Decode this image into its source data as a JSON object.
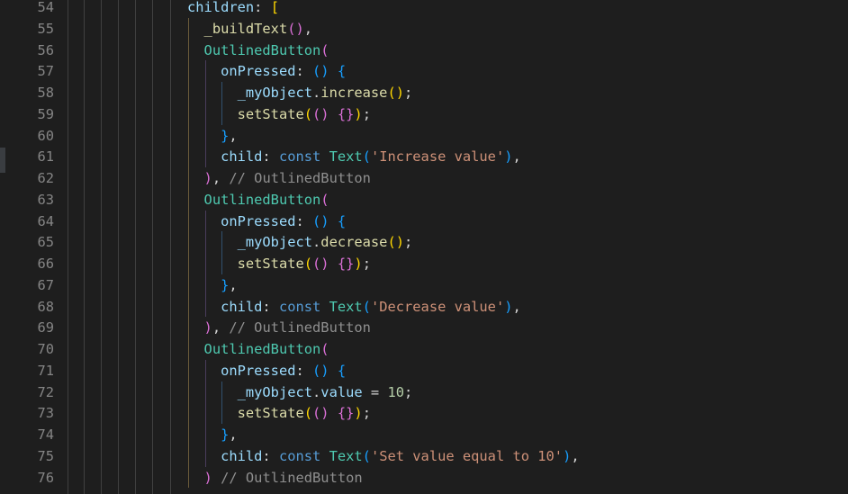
{
  "colors": {
    "background": "#1e1e1e",
    "line_number": "#858585",
    "keyword": "#569cd6",
    "class": "#4ec9b0",
    "function": "#dcdcaa",
    "property": "#9cdcfe",
    "string": "#ce9178",
    "number": "#b5cea8",
    "comment": "#8f8f8f",
    "bracket_gold": "#ffd700",
    "bracket_pink": "#da70d6",
    "bracket_blue": "#179fff",
    "plain": "#d4d4d4"
  },
  "editor": {
    "lines": [
      {
        "num": "54",
        "indent": "",
        "tokens": [
          {
            "t": "children",
            "c": "property"
          },
          {
            "t": ": ",
            "c": "plain"
          },
          {
            "t": "[",
            "c": "bracket_gold"
          }
        ]
      },
      {
        "num": "55",
        "indent": "  ",
        "tokens": [
          {
            "t": "_buildText",
            "c": "function"
          },
          {
            "t": "()",
            "c": "bracket_pink"
          },
          {
            "t": ",",
            "c": "plain"
          }
        ]
      },
      {
        "num": "56",
        "indent": "  ",
        "tokens": [
          {
            "t": "OutlinedButton",
            "c": "class"
          },
          {
            "t": "(",
            "c": "bracket_pink"
          }
        ]
      },
      {
        "num": "57",
        "indent": "    ",
        "tokens": [
          {
            "t": "onPressed",
            "c": "property"
          },
          {
            "t": ": ",
            "c": "plain"
          },
          {
            "t": "()",
            "c": "bracket_blue"
          },
          {
            "t": " ",
            "c": "plain"
          },
          {
            "t": "{",
            "c": "bracket_blue"
          }
        ]
      },
      {
        "num": "58",
        "indent": "      ",
        "tokens": [
          {
            "t": "_myObject",
            "c": "property"
          },
          {
            "t": ".",
            "c": "plain"
          },
          {
            "t": "increase",
            "c": "function"
          },
          {
            "t": "()",
            "c": "bracket_gold"
          },
          {
            "t": ";",
            "c": "plain"
          }
        ]
      },
      {
        "num": "59",
        "indent": "      ",
        "tokens": [
          {
            "t": "setState",
            "c": "function"
          },
          {
            "t": "(",
            "c": "bracket_gold"
          },
          {
            "t": "()",
            "c": "bracket_pink"
          },
          {
            "t": " ",
            "c": "plain"
          },
          {
            "t": "{}",
            "c": "bracket_pink"
          },
          {
            "t": ")",
            "c": "bracket_gold"
          },
          {
            "t": ";",
            "c": "plain"
          }
        ]
      },
      {
        "num": "60",
        "indent": "    ",
        "tokens": [
          {
            "t": "}",
            "c": "bracket_blue"
          },
          {
            "t": ",",
            "c": "plain"
          }
        ]
      },
      {
        "num": "61",
        "indent": "    ",
        "tokens": [
          {
            "t": "child",
            "c": "property"
          },
          {
            "t": ": ",
            "c": "plain"
          },
          {
            "t": "const",
            "c": "keyword"
          },
          {
            "t": " ",
            "c": "plain"
          },
          {
            "t": "Text",
            "c": "class"
          },
          {
            "t": "(",
            "c": "bracket_blue"
          },
          {
            "t": "'Increase value'",
            "c": "string"
          },
          {
            "t": ")",
            "c": "bracket_blue"
          },
          {
            "t": ",",
            "c": "plain"
          }
        ]
      },
      {
        "num": "62",
        "indent": "  ",
        "tokens": [
          {
            "t": ")",
            "c": "bracket_pink"
          },
          {
            "t": ", ",
            "c": "plain"
          },
          {
            "t": "// OutlinedButton",
            "c": "comment"
          }
        ]
      },
      {
        "num": "63",
        "indent": "  ",
        "tokens": [
          {
            "t": "OutlinedButton",
            "c": "class"
          },
          {
            "t": "(",
            "c": "bracket_pink"
          }
        ]
      },
      {
        "num": "64",
        "indent": "    ",
        "tokens": [
          {
            "t": "onPressed",
            "c": "property"
          },
          {
            "t": ": ",
            "c": "plain"
          },
          {
            "t": "()",
            "c": "bracket_blue"
          },
          {
            "t": " ",
            "c": "plain"
          },
          {
            "t": "{",
            "c": "bracket_blue"
          }
        ]
      },
      {
        "num": "65",
        "indent": "      ",
        "tokens": [
          {
            "t": "_myObject",
            "c": "property"
          },
          {
            "t": ".",
            "c": "plain"
          },
          {
            "t": "decrease",
            "c": "function"
          },
          {
            "t": "()",
            "c": "bracket_gold"
          },
          {
            "t": ";",
            "c": "plain"
          }
        ]
      },
      {
        "num": "66",
        "indent": "      ",
        "tokens": [
          {
            "t": "setState",
            "c": "function"
          },
          {
            "t": "(",
            "c": "bracket_gold"
          },
          {
            "t": "()",
            "c": "bracket_pink"
          },
          {
            "t": " ",
            "c": "plain"
          },
          {
            "t": "{}",
            "c": "bracket_pink"
          },
          {
            "t": ")",
            "c": "bracket_gold"
          },
          {
            "t": ";",
            "c": "plain"
          }
        ]
      },
      {
        "num": "67",
        "indent": "    ",
        "tokens": [
          {
            "t": "}",
            "c": "bracket_blue"
          },
          {
            "t": ",",
            "c": "plain"
          }
        ]
      },
      {
        "num": "68",
        "indent": "    ",
        "tokens": [
          {
            "t": "child",
            "c": "property"
          },
          {
            "t": ": ",
            "c": "plain"
          },
          {
            "t": "const",
            "c": "keyword"
          },
          {
            "t": " ",
            "c": "plain"
          },
          {
            "t": "Text",
            "c": "class"
          },
          {
            "t": "(",
            "c": "bracket_blue"
          },
          {
            "t": "'Decrease value'",
            "c": "string"
          },
          {
            "t": ")",
            "c": "bracket_blue"
          },
          {
            "t": ",",
            "c": "plain"
          }
        ]
      },
      {
        "num": "69",
        "indent": "  ",
        "tokens": [
          {
            "t": ")",
            "c": "bracket_pink"
          },
          {
            "t": ", ",
            "c": "plain"
          },
          {
            "t": "// OutlinedButton",
            "c": "comment"
          }
        ]
      },
      {
        "num": "70",
        "indent": "  ",
        "tokens": [
          {
            "t": "OutlinedButton",
            "c": "class"
          },
          {
            "t": "(",
            "c": "bracket_pink"
          }
        ]
      },
      {
        "num": "71",
        "indent": "    ",
        "tokens": [
          {
            "t": "onPressed",
            "c": "property"
          },
          {
            "t": ": ",
            "c": "plain"
          },
          {
            "t": "()",
            "c": "bracket_blue"
          },
          {
            "t": " ",
            "c": "plain"
          },
          {
            "t": "{",
            "c": "bracket_blue"
          }
        ]
      },
      {
        "num": "72",
        "indent": "      ",
        "tokens": [
          {
            "t": "_myObject",
            "c": "property"
          },
          {
            "t": ".",
            "c": "plain"
          },
          {
            "t": "value",
            "c": "property"
          },
          {
            "t": " = ",
            "c": "plain"
          },
          {
            "t": "10",
            "c": "number"
          },
          {
            "t": ";",
            "c": "plain"
          }
        ]
      },
      {
        "num": "73",
        "indent": "      ",
        "tokens": [
          {
            "t": "setState",
            "c": "function"
          },
          {
            "t": "(",
            "c": "bracket_gold"
          },
          {
            "t": "()",
            "c": "bracket_pink"
          },
          {
            "t": " ",
            "c": "plain"
          },
          {
            "t": "{}",
            "c": "bracket_pink"
          },
          {
            "t": ")",
            "c": "bracket_gold"
          },
          {
            "t": ";",
            "c": "plain"
          }
        ]
      },
      {
        "num": "74",
        "indent": "    ",
        "tokens": [
          {
            "t": "}",
            "c": "bracket_blue"
          },
          {
            "t": ",",
            "c": "plain"
          }
        ]
      },
      {
        "num": "75",
        "indent": "    ",
        "tokens": [
          {
            "t": "child",
            "c": "property"
          },
          {
            "t": ": ",
            "c": "plain"
          },
          {
            "t": "const",
            "c": "keyword"
          },
          {
            "t": " ",
            "c": "plain"
          },
          {
            "t": "Text",
            "c": "class"
          },
          {
            "t": "(",
            "c": "bracket_blue"
          },
          {
            "t": "'Set value equal to 10'",
            "c": "string"
          },
          {
            "t": ")",
            "c": "bracket_blue"
          },
          {
            "t": ",",
            "c": "plain"
          }
        ]
      },
      {
        "num": "76",
        "indent": "  ",
        "tokens": [
          {
            "t": ")",
            "c": "bracket_pink"
          },
          {
            "t": " ",
            "c": "plain"
          },
          {
            "t": "// OutlinedButton",
            "c": "comment"
          }
        ]
      }
    ]
  }
}
